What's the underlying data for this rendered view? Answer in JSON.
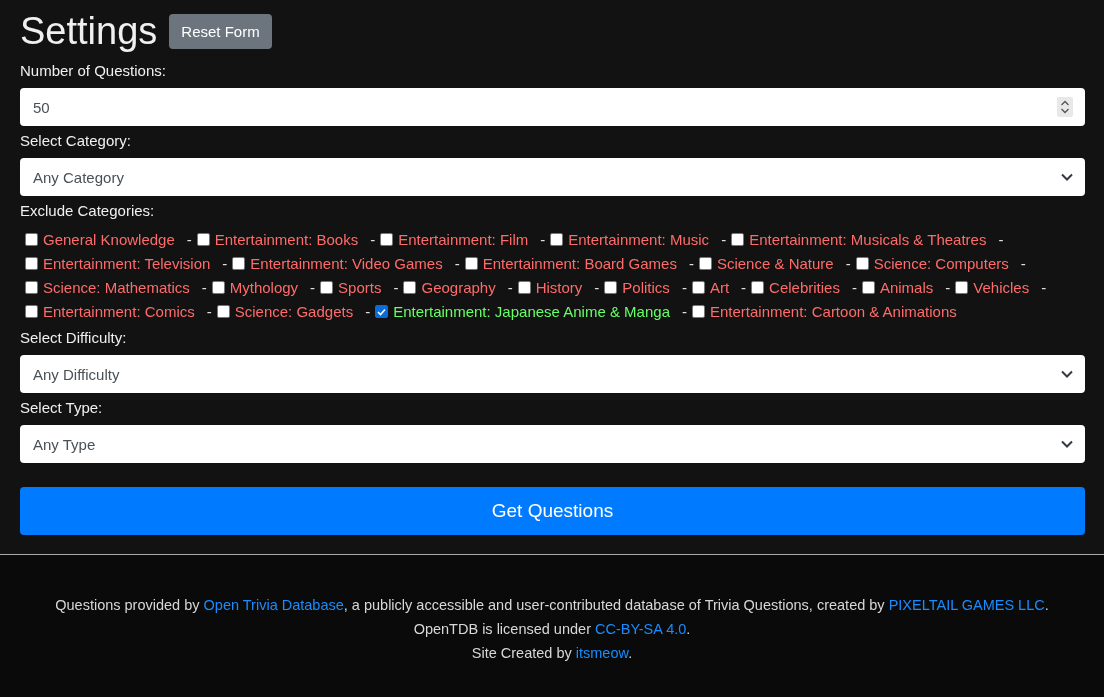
{
  "title": "Settings",
  "reset_button": "Reset Form",
  "number_of_questions": {
    "label": "Number of Questions:",
    "value": "50"
  },
  "category": {
    "label": "Select Category:",
    "value": "Any Category"
  },
  "exclude_categories": {
    "label": "Exclude Categories:",
    "items": [
      {
        "label": "General Knowledge",
        "checked": false,
        "suffix": "-"
      },
      {
        "label": "Entertainment: Books",
        "checked": false,
        "suffix": "-"
      },
      {
        "label": "Entertainment: Film",
        "checked": false,
        "suffix": "-"
      },
      {
        "label": "Entertainment: Music",
        "checked": false,
        "suffix": "-"
      },
      {
        "label": "Entertainment: Musicals & Theatres",
        "checked": false,
        "suffix": "-"
      },
      {
        "label": "Entertainment: Television",
        "checked": false,
        "suffix": "-"
      },
      {
        "label": "Entertainment: Video Games",
        "checked": false,
        "suffix": "-"
      },
      {
        "label": "Entertainment: Board Games",
        "checked": false,
        "suffix": "-"
      },
      {
        "label": "Science & Nature",
        "checked": false,
        "suffix": "-"
      },
      {
        "label": "Science: Computers",
        "checked": false,
        "suffix": "-"
      },
      {
        "label": "Science: Mathematics",
        "checked": false,
        "suffix": "-"
      },
      {
        "label": "Mythology",
        "checked": false,
        "suffix": "-"
      },
      {
        "label": "Sports",
        "checked": false,
        "suffix": "-"
      },
      {
        "label": "Geography",
        "checked": false,
        "suffix": "-"
      },
      {
        "label": "History",
        "checked": false,
        "suffix": "-"
      },
      {
        "label": "Politics",
        "checked": false,
        "suffix": "-"
      },
      {
        "label": "Art",
        "checked": false,
        "suffix": "-"
      },
      {
        "label": "Celebrities",
        "checked": false,
        "suffix": "-"
      },
      {
        "label": "Animals",
        "checked": false,
        "suffix": "-"
      },
      {
        "label": "Vehicles",
        "checked": false,
        "suffix": "-"
      },
      {
        "label": "Entertainment: Comics",
        "checked": false,
        "suffix": "-"
      },
      {
        "label": "Science: Gadgets",
        "checked": false,
        "suffix": "-"
      },
      {
        "label": "Entertainment: Japanese Anime & Manga",
        "checked": true,
        "suffix": "-"
      },
      {
        "label": "Entertainment: Cartoon & Animations",
        "checked": false
      }
    ]
  },
  "difficulty": {
    "label": "Select Difficulty:",
    "value": "Any Difficulty"
  },
  "type": {
    "label": "Select Type:",
    "value": "Any Type"
  },
  "submit_button": "Get Questions",
  "footer": [
    [
      {
        "kind": "text",
        "text": "Questions provided by "
      },
      {
        "kind": "link",
        "text": "Open Trivia Database"
      },
      {
        "kind": "text",
        "text": ", a publicly accessible and user-contributed database of Trivia Questions, created by "
      },
      {
        "kind": "link",
        "text": "PIXELTAIL GAMES LLC"
      },
      {
        "kind": "text",
        "text": "."
      }
    ],
    [
      {
        "kind": "text",
        "text": "OpenTDB is licensed under "
      },
      {
        "kind": "link",
        "text": "CC-BY-SA 4.0"
      },
      {
        "kind": "text",
        "text": "."
      }
    ],
    [
      {
        "kind": "text",
        "text": "Site Created by "
      },
      {
        "kind": "link",
        "text": "itsmeow"
      },
      {
        "kind": "text",
        "text": "."
      }
    ]
  ]
}
